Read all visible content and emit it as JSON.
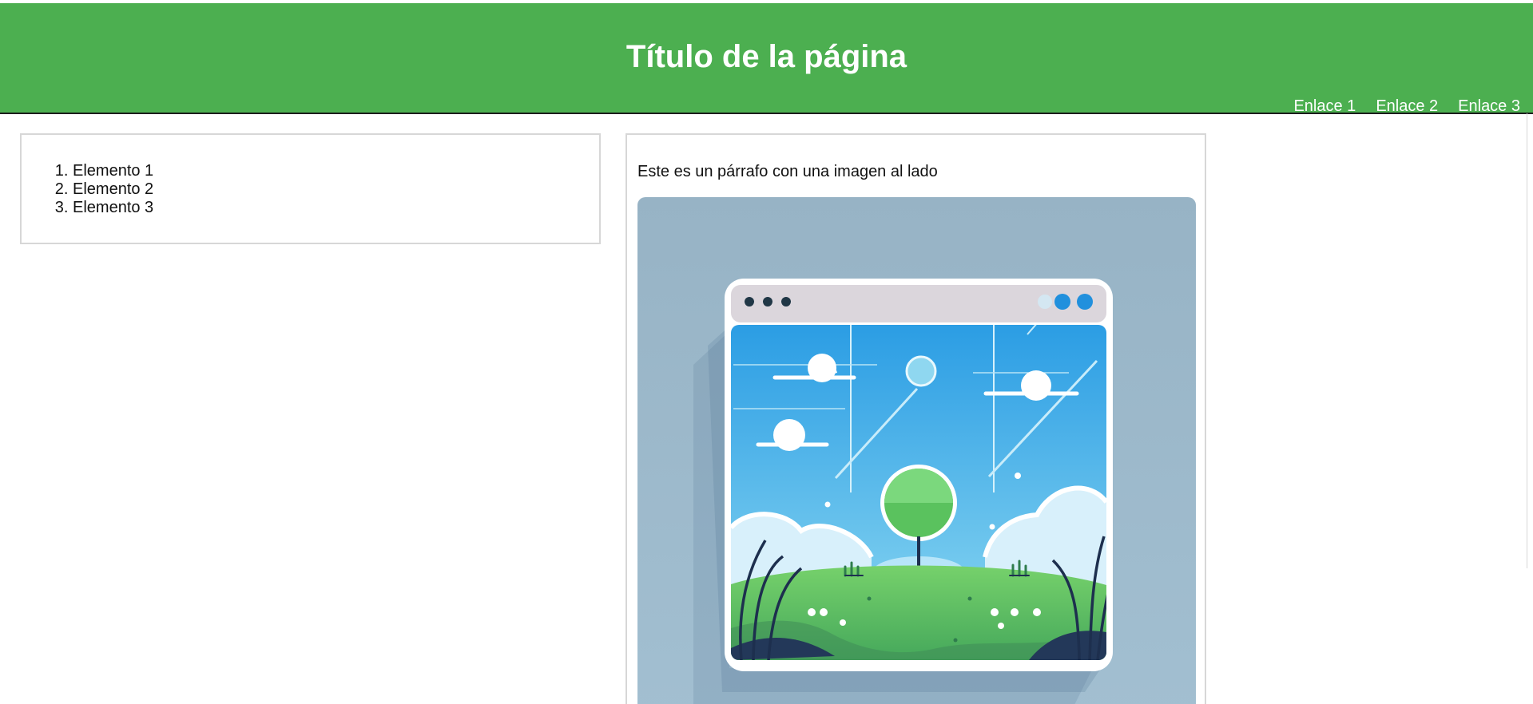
{
  "header": {
    "title": "Título de la página",
    "background_color": "#4caf50",
    "text_color": "#ffffff",
    "nav": [
      {
        "label": "Enlace 1"
      },
      {
        "label": "Enlace 2"
      },
      {
        "label": "Enlace 3"
      }
    ]
  },
  "list_panel": {
    "items": [
      "Elemento 1",
      "Elemento 2",
      "Elemento 3"
    ]
  },
  "media_panel": {
    "paragraph": "Este es un párrafo con una imagen al lado",
    "image_icon": "landscape-illustration"
  },
  "colors": {
    "panel_border": "#d7d7d7",
    "image_background": "#9bb8ca",
    "sky": "#43a4da",
    "grass": "#6fc65b",
    "tree": "#58b85b"
  }
}
